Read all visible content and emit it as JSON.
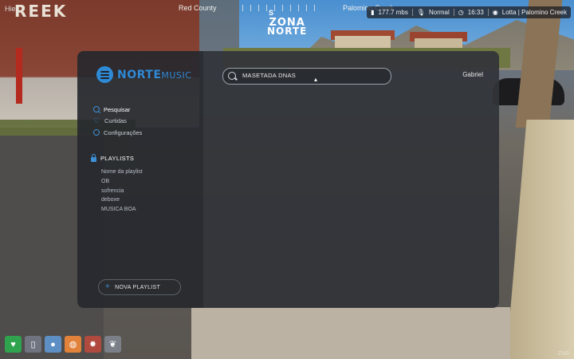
{
  "hud": {
    "top_left_label": "Hie",
    "compass_left_label": "Red County",
    "compass_heading": "S",
    "compass_right_label": "Palomino Creek",
    "speed": "177.7 mbs",
    "mic_label": "Normal",
    "time": "16:33",
    "location": "Lotta | Palomino Creek",
    "server_logo_line1": "ZONA",
    "server_logo_line2": "NORTE",
    "building_sign": "REEK"
  },
  "app": {
    "brand_name": "NORTE",
    "brand_suffix": "MUSIC",
    "user_name": "Gabriel",
    "search": {
      "value": "MASETADA DNAS",
      "placeholder": ""
    },
    "nav": [
      {
        "label": "Pesquisar",
        "icon": "search-icon",
        "active": true
      },
      {
        "label": "Curtidas",
        "icon": "heart-icon",
        "active": false
      },
      {
        "label": "Configurações",
        "icon": "gear-icon",
        "active": false
      }
    ],
    "playlists_header": "PLAYLISTS",
    "playlists": [
      "Nome da playlist",
      "OB",
      "sofrencia",
      "deboxe",
      "MUSICA BOA"
    ],
    "new_playlist_label": "NOVA PLAYLIST"
  },
  "status_bar": [
    {
      "icon": "heart-icon",
      "color": "#2fa34d"
    },
    {
      "icon": "bottle-icon",
      "color": "#6f7480"
    },
    {
      "icon": "water-drop-icon",
      "color": "#5d8fc4"
    },
    {
      "icon": "food-icon",
      "color": "#e0823a"
    },
    {
      "icon": "stress-icon",
      "color": "#b04a3e"
    },
    {
      "icon": "lungs-icon",
      "color": "#7a7f88"
    }
  ],
  "watermark": "ZNR"
}
